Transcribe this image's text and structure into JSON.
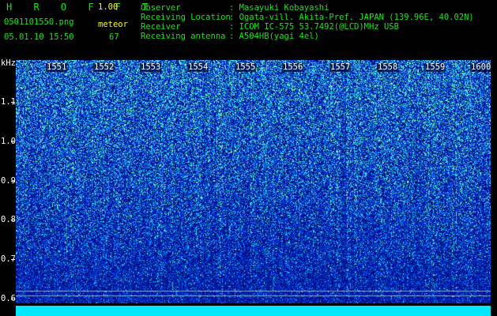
{
  "app": {
    "logo_letters": "H R O F F T",
    "version": "1.00",
    "filename": "0501101550.png",
    "mode": "meteor",
    "datetime": "05.01.10 15:50",
    "count": "67"
  },
  "station": {
    "observer_label": "Observer",
    "observer_value": ": Masayuki Kobayashi",
    "location_label": "Receiving Location",
    "location_value": ": Ogata-vill. Akita-Pref. JAPAN (139.96E, 40.02N)",
    "receiver_label": "Receiver",
    "receiver_value": ": ICOM IC-575 53.7492(@LCD)MHz USB",
    "antenna_label": "Receiving antenna",
    "antenna_value": ": A504HB(yagi 4el)"
  },
  "axis": {
    "unit": "kHz",
    "y_labels": [
      "1.1",
      "1.0",
      "0.9",
      "0.8",
      "0.7",
      "0.6"
    ],
    "time_labels": [
      "1551",
      "1552",
      "1553",
      "1554",
      "1555",
      "1556",
      "1557",
      "1558",
      "1559",
      "1600"
    ]
  },
  "colors": {
    "background": "#000000",
    "header_text": "#19e619",
    "mode_text": "#ffff00",
    "spectrum_base": "#001a8c",
    "signal_bar": "#00e8ff"
  }
}
